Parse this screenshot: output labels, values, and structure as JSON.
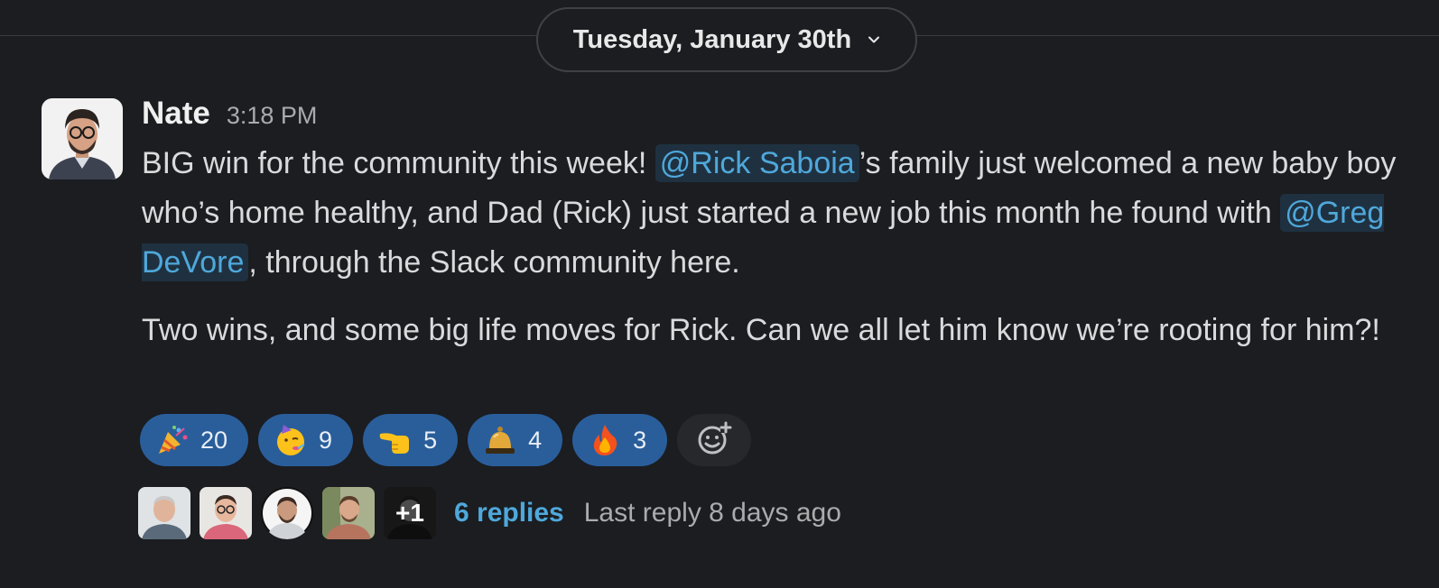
{
  "date_divider": {
    "label": "Tuesday, January 30th"
  },
  "message": {
    "author": "Nate",
    "time": "3:18 PM",
    "p1_before": "BIG win for the community this week! ",
    "mention1": "@Rick Saboia",
    "p1_mid": "’s family just welcomed a new baby boy who’s home healthy, and Dad (Rick) just started a new job this month he found with ",
    "mention2": "@Greg DeVore",
    "p1_after": ", through the Slack community here.",
    "p2": "Two wins, and some big life moves for Rick. Can we all let him know we’re rooting for him?!"
  },
  "reactions": [
    {
      "icon": "party-popper-icon",
      "count": "20"
    },
    {
      "icon": "partying-face-icon",
      "count": "9"
    },
    {
      "icon": "pointing-hand-icon",
      "count": "5"
    },
    {
      "icon": "bell-icon",
      "count": "4"
    },
    {
      "icon": "fire-icon",
      "count": "3"
    }
  ],
  "thread": {
    "more_count": "+1",
    "replies_label": "6 replies",
    "last_reply": "Last reply 8 days ago"
  },
  "colors": {
    "background": "#1b1d21",
    "link": "#4fa8db",
    "reaction_bg": "#2a5e9b"
  }
}
